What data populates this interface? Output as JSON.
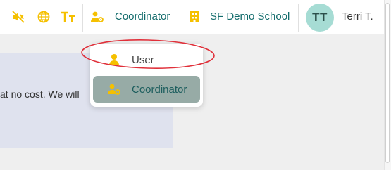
{
  "header": {
    "role_label": "Coordinator",
    "school_label": "SF Demo School",
    "user_initials": "TT",
    "user_name": "Terri T.",
    "icons": [
      "mute-icon",
      "globe-icon",
      "text-size-icon",
      "user-gear-icon",
      "building-icon"
    ]
  },
  "content": {
    "partial_text": "at no cost. We will"
  },
  "role_menu": {
    "items": [
      {
        "label": "User",
        "icon": "user-icon",
        "selected": false
      },
      {
        "label": "Coordinator",
        "icon": "user-gear-icon",
        "selected": true
      }
    ]
  },
  "colors": {
    "accent_yellow": "#f5c000",
    "teal_text": "#136c6c",
    "avatar_bg": "#a6dcd4",
    "selected_bg": "#97aba6",
    "annotation": "#e0303a"
  }
}
